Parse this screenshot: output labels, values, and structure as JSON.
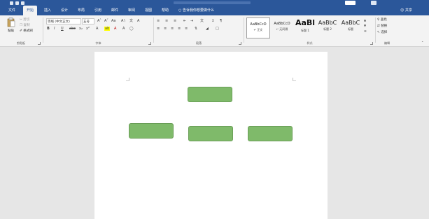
{
  "colors": {
    "accent": "#2b579a",
    "shape_fill": "#7fba6a",
    "ribbon_bg": "#f3f3f3",
    "page_bg": "#ffffff"
  },
  "tabs": [
    "文件",
    "开始",
    "插入",
    "设计",
    "布局",
    "引用",
    "邮件",
    "审阅",
    "视图",
    "帮助"
  ],
  "active_tab": "开始",
  "tell_me": "告诉我你想要做什么",
  "share": "共享",
  "clipboard": {
    "paste": "粘贴",
    "cut": "剪切",
    "copy": "复制",
    "format_painter": "格式刷",
    "label": "剪贴板"
  },
  "font": {
    "name": "等线 (中文正文)",
    "size": "五号",
    "label": "字体"
  },
  "paragraph": {
    "label": "段落"
  },
  "styles": {
    "items": [
      {
        "sample": "AaBbCcD",
        "name": "↵ 正文"
      },
      {
        "sample": "AaBbCcD",
        "name": "↵ 无间隔"
      },
      {
        "sample": "AaBl",
        "name": "标题 1"
      },
      {
        "sample": "AaBbC",
        "name": "标题 2"
      },
      {
        "sample": "AaBbC",
        "name": "标题"
      }
    ],
    "label": "样式"
  },
  "editing": {
    "find": "查找",
    "replace": "替换",
    "select": "选择",
    "label": "编辑"
  },
  "icons": {
    "paste": "paste-icon",
    "cut": "scissors-icon",
    "copy": "copy-icon",
    "format_painter": "brush-icon",
    "find": "magnifier-icon",
    "replace": "replace-icon",
    "select": "cursor-icon",
    "tell_me": "lightbulb-icon",
    "share": "person-icon"
  }
}
